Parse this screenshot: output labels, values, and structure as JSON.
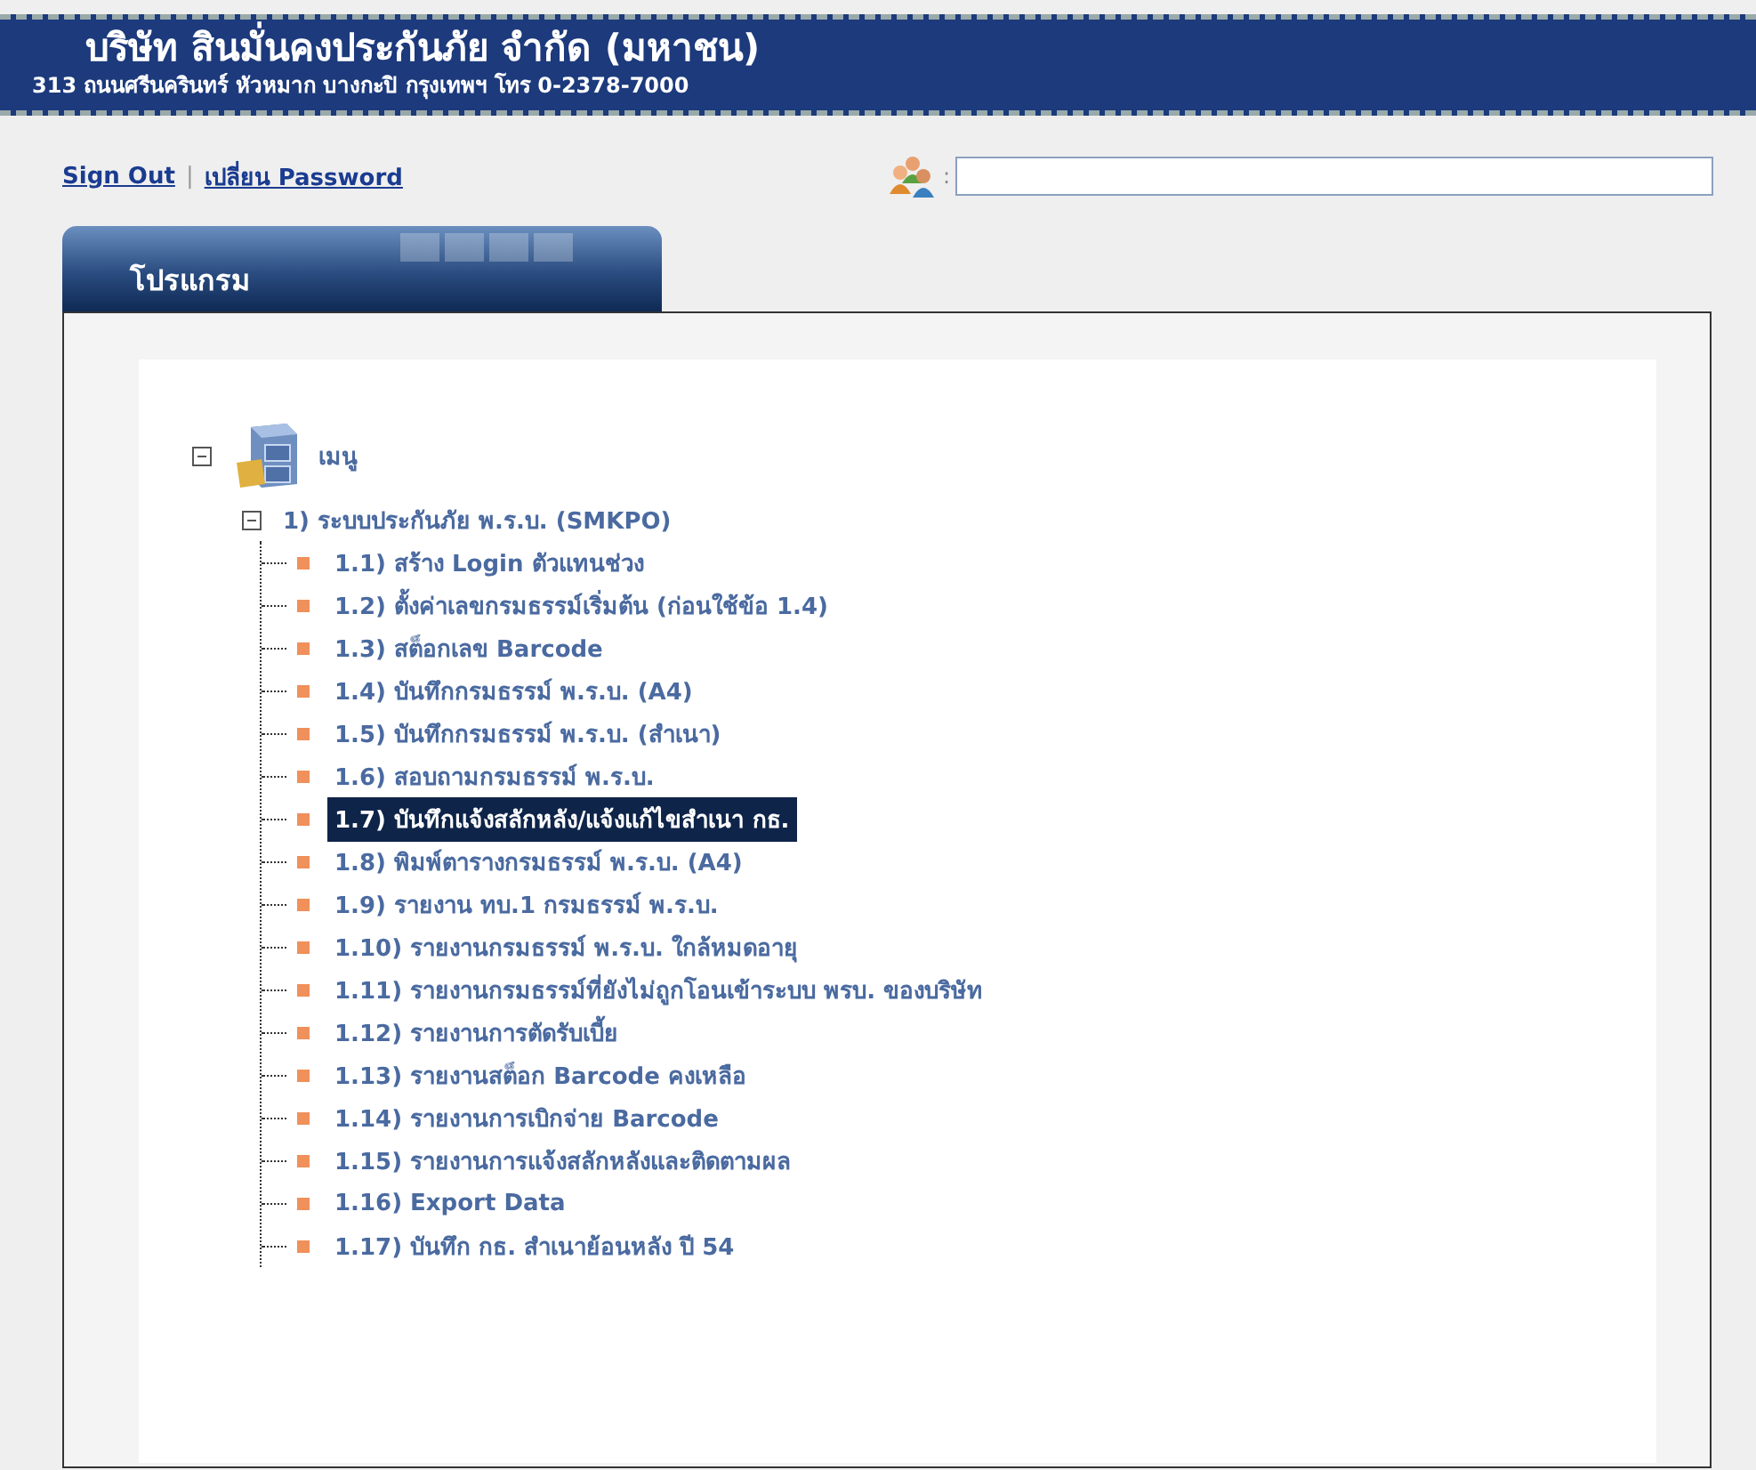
{
  "header": {
    "company": "บริษัท สินมั่นคงประกันภัย จำกัด (มหาชน)",
    "address": "313 ถนนศรีนครินทร์ หัวหมาก บางกะปิ กรุงเทพฯ โทร 0-2378-7000"
  },
  "links": [
    {
      "label": "Sign Out"
    },
    {
      "label": "เปลี่ยน Password"
    }
  ],
  "link_separator": "|",
  "user_field": {
    "separator": ":"
  },
  "tab": {
    "label": "โปรแกรม"
  },
  "tree": {
    "label": "เมนู",
    "expanded": true,
    "children": [
      {
        "label": "1) ระบบประกันภัย พ.ร.บ. (SMKPO)",
        "expanded": true,
        "children": [
          {
            "label": "1.1) สร้าง Login ตัวแทนช่วง",
            "selected": false
          },
          {
            "label": "1.2) ตั้งค่าเลขกรมธรรม์เริ่มต้น (ก่อนใช้ข้อ 1.4)",
            "selected": false
          },
          {
            "label": "1.3) สต็อกเลข Barcode",
            "selected": false
          },
          {
            "label": "1.4) บันทึกกรมธรรม์ พ.ร.บ. (A4)",
            "selected": false
          },
          {
            "label": "1.5) บันทึกกรมธรรม์ พ.ร.บ. (สำเนา)",
            "selected": false
          },
          {
            "label": "1.6) สอบถามกรมธรรม์ พ.ร.บ.",
            "selected": false
          },
          {
            "label": "1.7) บันทึกแจ้งสลักหลัง/แจ้งแก้ไขสำเนา กธ.",
            "selected": true
          },
          {
            "label": "1.8) พิมพ์ตารางกรมธรรม์ พ.ร.บ. (A4)",
            "selected": false
          },
          {
            "label": "1.9) รายงาน ทบ.1 กรมธรรม์ พ.ร.บ.",
            "selected": false
          },
          {
            "label": "1.10) รายงานกรมธรรม์ พ.ร.บ. ใกล้หมดอายุ",
            "selected": false
          },
          {
            "label": "1.11) รายงานกรมธรรม์ที่ยังไม่ถูกโอนเข้าระบบ พรบ. ของบริษัท",
            "selected": false
          },
          {
            "label": "1.12) รายงานการตัดรับเบี้ย",
            "selected": false
          },
          {
            "label": "1.13) รายงานสต็อก Barcode คงเหลือ",
            "selected": false
          },
          {
            "label": "1.14) รายงานการเบิกจ่าย Barcode",
            "selected": false
          },
          {
            "label": "1.15) รายงานการแจ้งสลักหลังและติดตามผล",
            "selected": false
          },
          {
            "label": "1.16) Export Data",
            "selected": false
          },
          {
            "label": "1.17) บันทึก กธ. สำเนาย้อนหลัง ปี 54",
            "selected": false
          }
        ]
      }
    ]
  }
}
